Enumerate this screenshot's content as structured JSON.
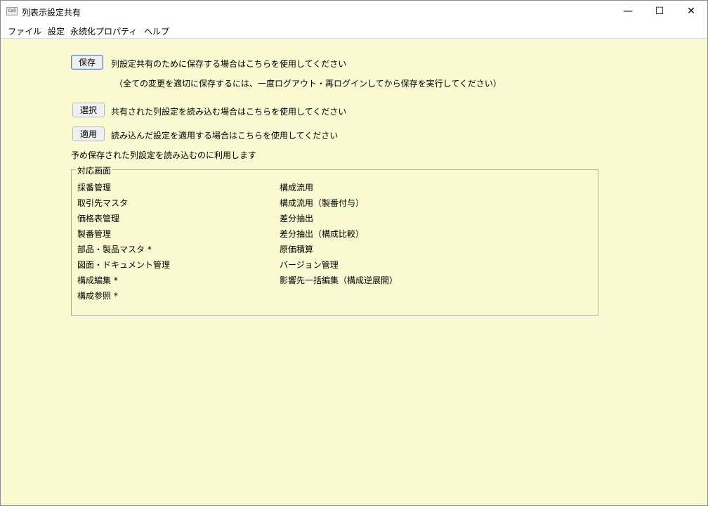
{
  "window": {
    "title": "列表示設定共有",
    "icon_text": "Cell",
    "controls": {
      "minimize": "—",
      "maximize": "☐",
      "close": "✕"
    }
  },
  "menubar": [
    "ファイル",
    "設定",
    "永続化プロパティ",
    "ヘルプ"
  ],
  "actions": {
    "save": {
      "button": "保存",
      "description": "列設定共有のために保存する場合はこちらを使用してください",
      "note": "（全ての変更を適切に保存するには、一度ログアウト・再ログインしてから保存を実行してください）"
    },
    "select": {
      "button": "選択",
      "description": "共有された列設定を読み込む場合はこちらを使用してください"
    },
    "apply": {
      "button": "適用",
      "description": "読み込んだ設定を適用する場合はこちらを使用してください"
    }
  },
  "info_text": "予め保存された列設定を読み込むのに利用します",
  "supported_screens": {
    "title": "対応画面",
    "left_column": [
      "採番管理",
      "取引先マスタ",
      "価格表管理",
      "製番管理",
      "部品・製品マスタ *",
      "図面・ドキュメント管理",
      "構成編集 *",
      "構成参照 *"
    ],
    "right_column": [
      "構成流用",
      "構成流用（製番付与）",
      "差分抽出",
      "差分抽出（構成比較）",
      "原価積算",
      "バージョン管理",
      "影響先一括編集（構成逆展開）"
    ]
  }
}
